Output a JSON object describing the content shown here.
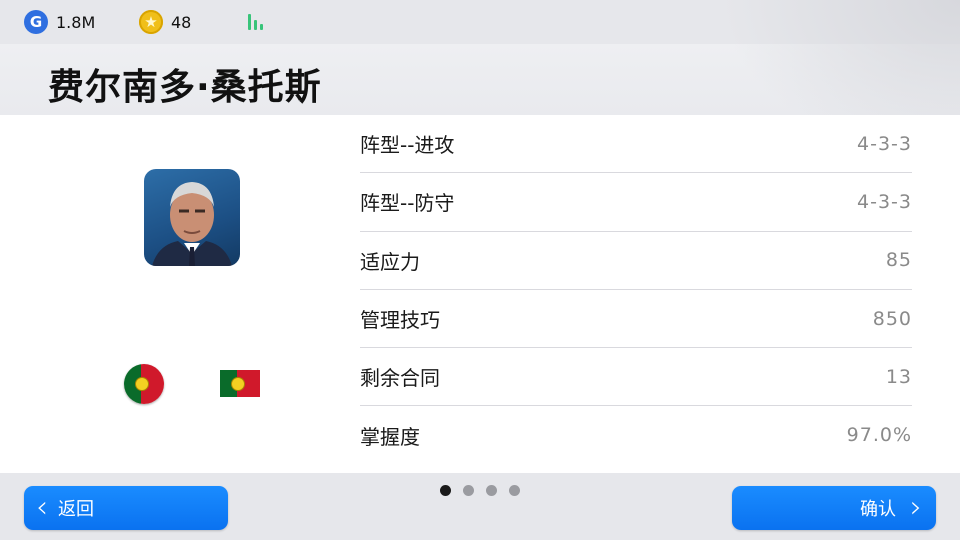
{
  "topbar": {
    "gp_icon": "G",
    "gp_value": "1.8M",
    "coin_icon": "★",
    "coin_value": "48",
    "signal_icon": "signal-bars-icon"
  },
  "header": {
    "title": "费尔南多·桑托斯"
  },
  "manager": {
    "portrait_icon": "manager-portrait",
    "nationality": "portugal-flag"
  },
  "stats": [
    {
      "label": "阵型--进攻",
      "value": "4-3-3"
    },
    {
      "label": "阵型--防守",
      "value": "4-3-3"
    },
    {
      "label": "适应力",
      "value": "85"
    },
    {
      "label": "管理技巧",
      "value": "850"
    },
    {
      "label": "剩余合同",
      "value": "13"
    },
    {
      "label": "掌握度",
      "value": "97.0%"
    }
  ],
  "pager": {
    "count": 4,
    "active": 1
  },
  "buttons": {
    "back_label": "返回",
    "confirm_label": "确认"
  },
  "colors": {
    "accent": "#0a72f0",
    "signal": "#38c47a",
    "coin": "#f0bf1a",
    "gp": "#2f6fe0"
  }
}
